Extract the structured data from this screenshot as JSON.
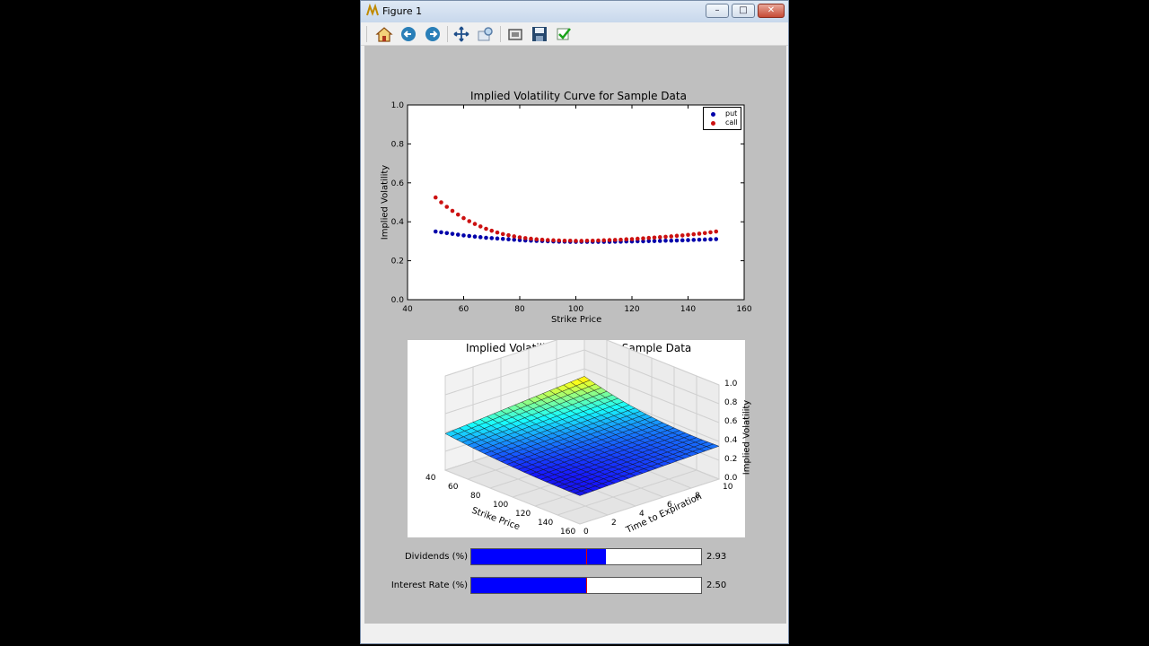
{
  "window": {
    "title": "Figure 1",
    "minimize": "–",
    "maximize": "□",
    "close": "✕"
  },
  "toolbar": [
    {
      "name": "home-icon",
      "glyph": "⌂"
    },
    {
      "name": "back-icon",
      "glyph": "◀"
    },
    {
      "name": "forward-icon",
      "glyph": "▶"
    },
    {
      "name": "pan-icon",
      "glyph": "✥"
    },
    {
      "name": "zoom-icon",
      "glyph": "⌕"
    },
    {
      "name": "subplots-icon",
      "glyph": "▦"
    },
    {
      "name": "save-icon",
      "glyph": "💾"
    },
    {
      "name": "edit-icon",
      "glyph": "✔"
    }
  ],
  "colors": {
    "put": "#0000aa",
    "call": "#cc1111",
    "slider_fill": "#0000ff",
    "canvas": "#bfbfbf"
  },
  "plot1": {
    "title": "Implied Volatility Curve for Sample Data",
    "xlabel": "Strike Price",
    "ylabel": "Implied Volatility",
    "legend": [
      {
        "label": "put"
      },
      {
        "label": "call"
      }
    ]
  },
  "plot2": {
    "title": "Implied Volatility Surface for Sample Data",
    "xlabel": "Strike Price",
    "ylabel": "Time to Expiration",
    "zlabel": "Implied Volatility",
    "xticks": [
      "40",
      "60",
      "80",
      "100",
      "120",
      "140",
      "160"
    ],
    "yticks": [
      "0",
      "2",
      "4",
      "6",
      "8",
      "10"
    ],
    "zticks": [
      "0.0",
      "0.2",
      "0.4",
      "0.6",
      "0.8",
      "1.0"
    ]
  },
  "chart_data": [
    {
      "type": "scatter",
      "title": "Implied Volatility Curve for Sample Data",
      "xlabel": "Strike Price",
      "ylabel": "Implied Volatility",
      "xlim": [
        40,
        160
      ],
      "ylim": [
        0.0,
        1.0
      ],
      "xticks": [
        40,
        60,
        80,
        100,
        120,
        140,
        160
      ],
      "yticks": [
        0.0,
        0.2,
        0.4,
        0.6,
        0.8,
        1.0
      ],
      "legend_position": "top-right",
      "series": [
        {
          "name": "put",
          "x": [
            50,
            52,
            54,
            56,
            58,
            60,
            62,
            64,
            66,
            68,
            70,
            72,
            74,
            76,
            78,
            80,
            82,
            84,
            86,
            88,
            90,
            92,
            94,
            96,
            98,
            100,
            102,
            104,
            106,
            108,
            110,
            112,
            114,
            116,
            118,
            120,
            122,
            124,
            126,
            128,
            130,
            132,
            134,
            136,
            138,
            140,
            142,
            144,
            146,
            148,
            150
          ],
          "y": [
            0.35,
            0.346,
            0.342,
            0.338,
            0.334,
            0.33,
            0.327,
            0.324,
            0.321,
            0.318,
            0.316,
            0.314,
            0.312,
            0.31,
            0.308,
            0.306,
            0.304,
            0.303,
            0.302,
            0.301,
            0.3,
            0.299,
            0.298,
            0.298,
            0.297,
            0.297,
            0.297,
            0.297,
            0.297,
            0.297,
            0.297,
            0.297,
            0.298,
            0.298,
            0.299,
            0.299,
            0.3,
            0.3,
            0.301,
            0.301,
            0.302,
            0.303,
            0.303,
            0.304,
            0.305,
            0.306,
            0.307,
            0.308,
            0.309,
            0.31,
            0.311
          ]
        },
        {
          "name": "call",
          "x": [
            50,
            52,
            54,
            56,
            58,
            60,
            62,
            64,
            66,
            68,
            70,
            72,
            74,
            76,
            78,
            80,
            82,
            84,
            86,
            88,
            90,
            92,
            94,
            96,
            98,
            100,
            102,
            104,
            106,
            108,
            110,
            112,
            114,
            116,
            118,
            120,
            122,
            124,
            126,
            128,
            130,
            132,
            134,
            136,
            138,
            140,
            142,
            144,
            146,
            148,
            150
          ],
          "y": [
            0.525,
            0.5,
            0.477,
            0.456,
            0.437,
            0.419,
            0.403,
            0.389,
            0.376,
            0.364,
            0.354,
            0.345,
            0.337,
            0.331,
            0.325,
            0.32,
            0.316,
            0.313,
            0.31,
            0.308,
            0.306,
            0.305,
            0.304,
            0.303,
            0.303,
            0.302,
            0.302,
            0.303,
            0.303,
            0.304,
            0.305,
            0.306,
            0.307,
            0.308,
            0.31,
            0.311,
            0.313,
            0.315,
            0.317,
            0.319,
            0.321,
            0.323,
            0.325,
            0.328,
            0.33,
            0.333,
            0.336,
            0.339,
            0.342,
            0.346,
            0.35
          ]
        }
      ]
    },
    {
      "type": "surface3d",
      "title": "Implied Volatility Surface for Sample Data",
      "xlabel": "Strike Price",
      "ylabel": "Time to Expiration",
      "zlabel": "Implied Volatility",
      "xlim": [
        40,
        160
      ],
      "ylim": [
        0,
        10
      ],
      "zlim": [
        0.0,
        1.0
      ]
    }
  ],
  "sliders": [
    {
      "label": "Dividends (%)",
      "value_text": "2.93",
      "fill": 0.587,
      "init": 0.5
    },
    {
      "label": "Interest Rate (%)",
      "value_text": "2.50",
      "fill": 0.5,
      "init": 0.5
    }
  ]
}
